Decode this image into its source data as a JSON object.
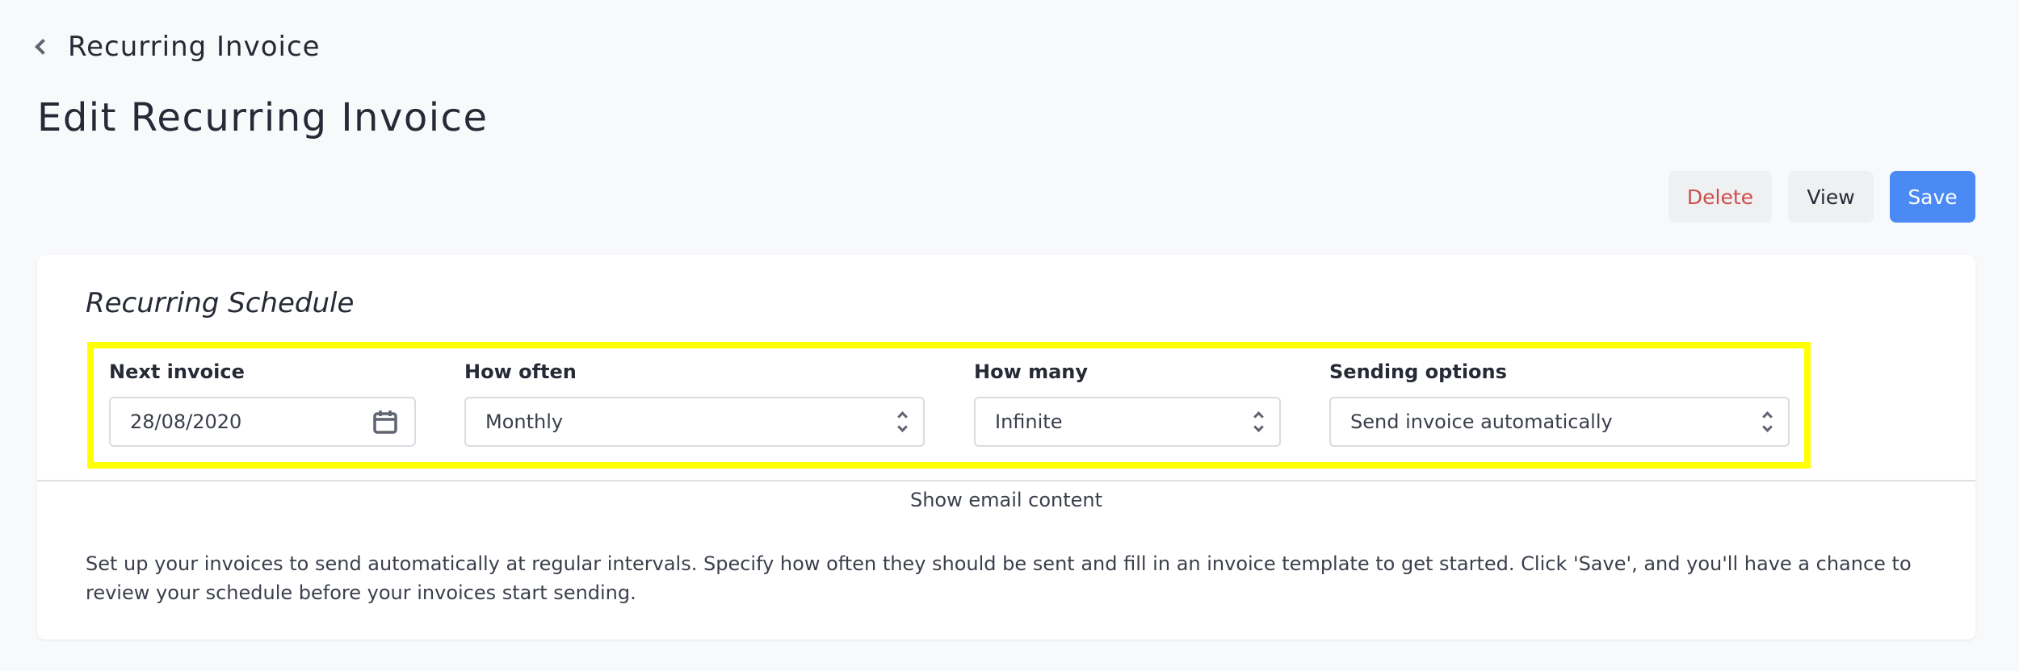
{
  "header": {
    "back_label": "Recurring Invoice",
    "back_icon": "chevron-left-icon",
    "page_title": "Edit Recurring Invoice"
  },
  "actions": {
    "delete_label": "Delete",
    "view_label": "View",
    "save_label": "Save",
    "colors": {
      "delete_text": "#cc4f4c",
      "save_bg": "#4b8af4",
      "secondary_bg": "#eff0f2"
    }
  },
  "schedule": {
    "title": "Recurring Schedule",
    "highlight_color": "#ffff00",
    "fields": {
      "next_invoice": {
        "label": "Next invoice",
        "value": "28/08/2020",
        "icon": "calendar-icon"
      },
      "how_often": {
        "label": "How often",
        "value": "Monthly",
        "icon": "chevron-up-down-icon"
      },
      "how_many": {
        "label": "How many",
        "value": "Infinite",
        "icon": "chevron-up-down-icon"
      },
      "sending_options": {
        "label": "Sending options",
        "value": "Send invoice automatically",
        "icon": "chevron-up-down-icon"
      }
    },
    "show_email_label": "Show email content",
    "description": "Set up your invoices to send automatically at regular intervals. Specify how often they should be sent and fill in an invoice template to get started. Click 'Save', and you'll have a chance to review your schedule before your invoices start sending."
  }
}
